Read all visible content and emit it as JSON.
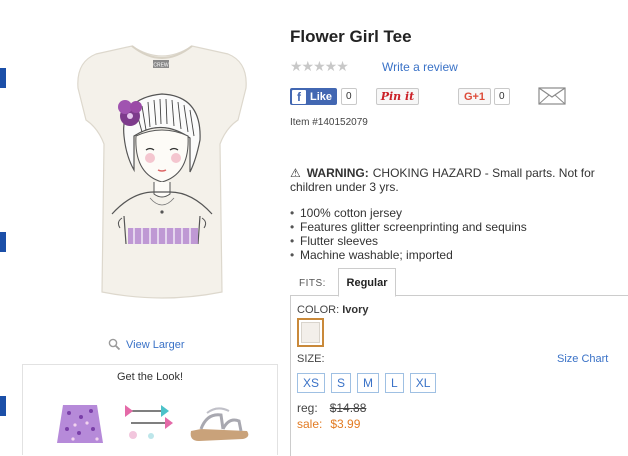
{
  "product": {
    "title": "Flower Girl Tee",
    "item_number": "Item #140152079",
    "rating_stars": "★★★★★",
    "write_review": "Write a review"
  },
  "social": {
    "fb_label": "Like",
    "fb_glyph": "f",
    "fb_count": "0",
    "pinit_label": "Pin it",
    "gplus_label": "G+1",
    "gplus_count": "0",
    "mail_icon": "envelope-icon"
  },
  "image": {
    "view_larger": "View Larger",
    "shirt_tag": "CREW"
  },
  "get_look": {
    "title": "Get the Look!"
  },
  "warning": {
    "icon": "⚠",
    "label": "WARNING:",
    "text": "CHOKING HAZARD - Small parts. Not for children under 3 yrs."
  },
  "features": [
    "100% cotton jersey",
    "Features glitter screenprinting and sequins",
    "Flutter sleeves",
    "Machine washable; imported"
  ],
  "fits": {
    "label": "FITS:",
    "selected": "Regular"
  },
  "color": {
    "label": "COLOR:",
    "value": "Ivory",
    "swatch_hex": "#f3efea"
  },
  "size": {
    "label": "SIZE:",
    "chart_link": "Size Chart",
    "options": [
      "XS",
      "S",
      "M",
      "L",
      "XL"
    ]
  },
  "price": {
    "reg_label": "reg:",
    "reg_value": "$14.88",
    "sale_label": "sale:",
    "sale_value": "$3.99"
  },
  "colors": {
    "link": "#3a72c7",
    "sale": "#e27b22",
    "facebook": "#4267b2",
    "pinterest": "#cb2027",
    "accent_edge": "#1b4fa8"
  }
}
